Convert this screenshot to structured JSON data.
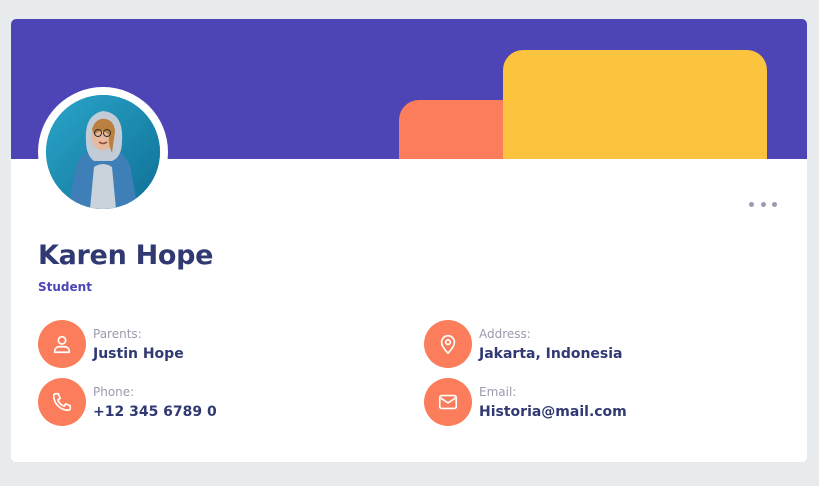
{
  "profile": {
    "name": "Karen Hope",
    "role": "Student"
  },
  "details": {
    "parents": {
      "label": "Parents:",
      "value": "Justin Hope",
      "icon": "user-icon"
    },
    "address": {
      "label": "Address:",
      "value": "Jakarta, Indonesia",
      "icon": "map-pin-icon"
    },
    "phone": {
      "label": "Phone:",
      "value": "+12 345 6789 0",
      "icon": "phone-icon"
    },
    "email": {
      "label": "Email:",
      "value": "Historia@mail.com",
      "icon": "mail-icon"
    }
  },
  "menu": {
    "icon": "more-horizontal-icon"
  },
  "colors": {
    "page_background": "#e7ebee",
    "banner": "#4d44b5",
    "accent_orange": "#fb7d5b",
    "accent_yellow": "#fcc43e",
    "text_primary": "#303972",
    "text_secondary": "#a098ae"
  }
}
